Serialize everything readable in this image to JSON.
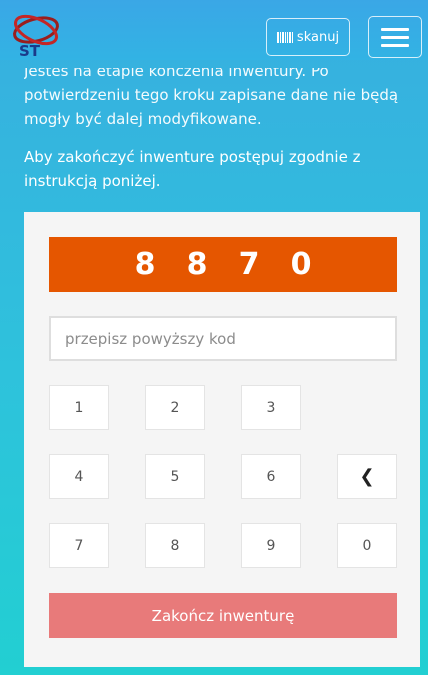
{
  "header": {
    "logo_text": "ST",
    "scan_label": "skanuj",
    "menu_icon": "hamburger-icon"
  },
  "intro_text": "Jesteś na etapie kończenia inwentury. Po potwierdzeniu tego kroku zapisane dane nie będą mogły być dalej modyfikowane.",
  "instruction_text": "Aby zakończyć inwenture postępuj zgodnie z instrukcją poniżej.",
  "code": {
    "digits": [
      "8",
      "8",
      "7",
      "0"
    ]
  },
  "code_input": {
    "placeholder": "przepisz powyższy kod",
    "value": ""
  },
  "keypad": {
    "k1": "1",
    "k2": "2",
    "k3": "3",
    "k4": "4",
    "k5": "5",
    "k6": "6",
    "k7": "7",
    "k8": "8",
    "k9": "9",
    "k0": "0",
    "backspace": "❮"
  },
  "finish_label": "Zakończ inwenturę",
  "colors": {
    "code_bg": "#e55600",
    "finish_bg": "#e87a7a"
  }
}
